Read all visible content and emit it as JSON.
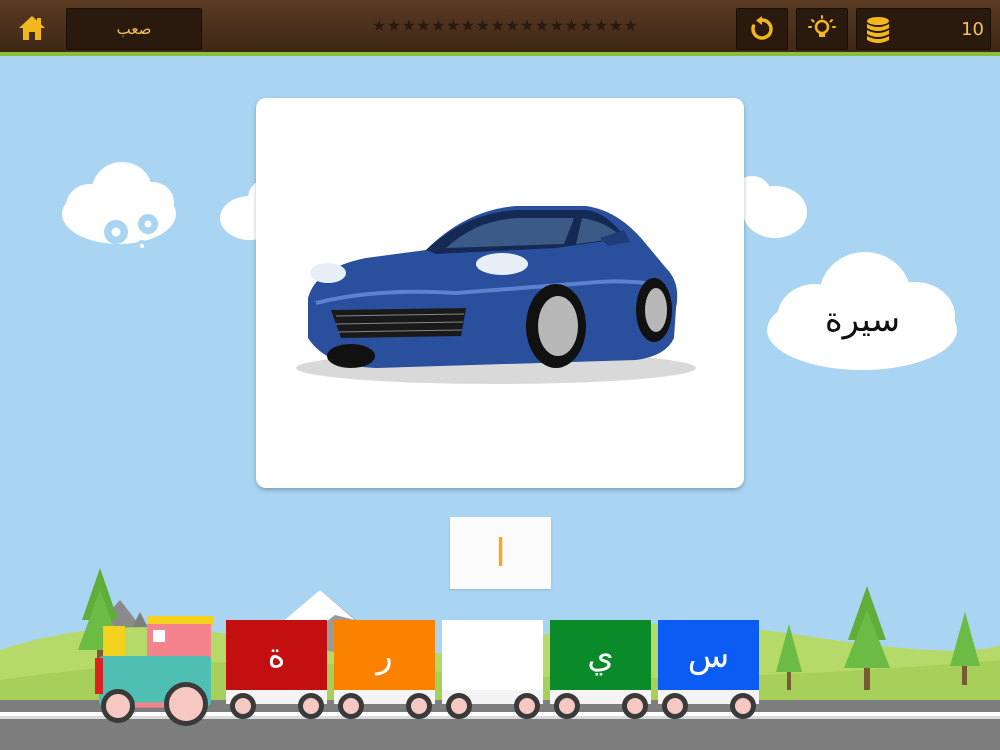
{
  "header": {
    "level_label": "صعب",
    "stars": [
      "★",
      "★",
      "★",
      "★",
      "★",
      "★",
      "★",
      "★",
      "★",
      "★",
      "★",
      "★",
      "★",
      "★",
      "★",
      "★",
      "★",
      "★"
    ],
    "coin_count": "10"
  },
  "card": {
    "word": "سيرة"
  },
  "draggable_letter": "ا",
  "train": {
    "wagons": [
      {
        "letter": "ة",
        "color": "#c40f10"
      },
      {
        "letter": "ر",
        "color": "#fb8200"
      },
      {
        "letter": "",
        "color": "#ffffff"
      },
      {
        "letter": "ي",
        "color": "#0b8a29"
      },
      {
        "letter": "س",
        "color": "#0a5cf2"
      }
    ]
  },
  "colors": {
    "topbar": "#4a2f1b",
    "accent_text": "#f2c35c",
    "sky": "#a9d4f2",
    "grass": "#a7d05a"
  },
  "icons": {
    "home": "home-icon",
    "reset": "reset-icon",
    "hint": "lightbulb-icon",
    "coins": "coins-icon",
    "settings": "gear-icon"
  }
}
